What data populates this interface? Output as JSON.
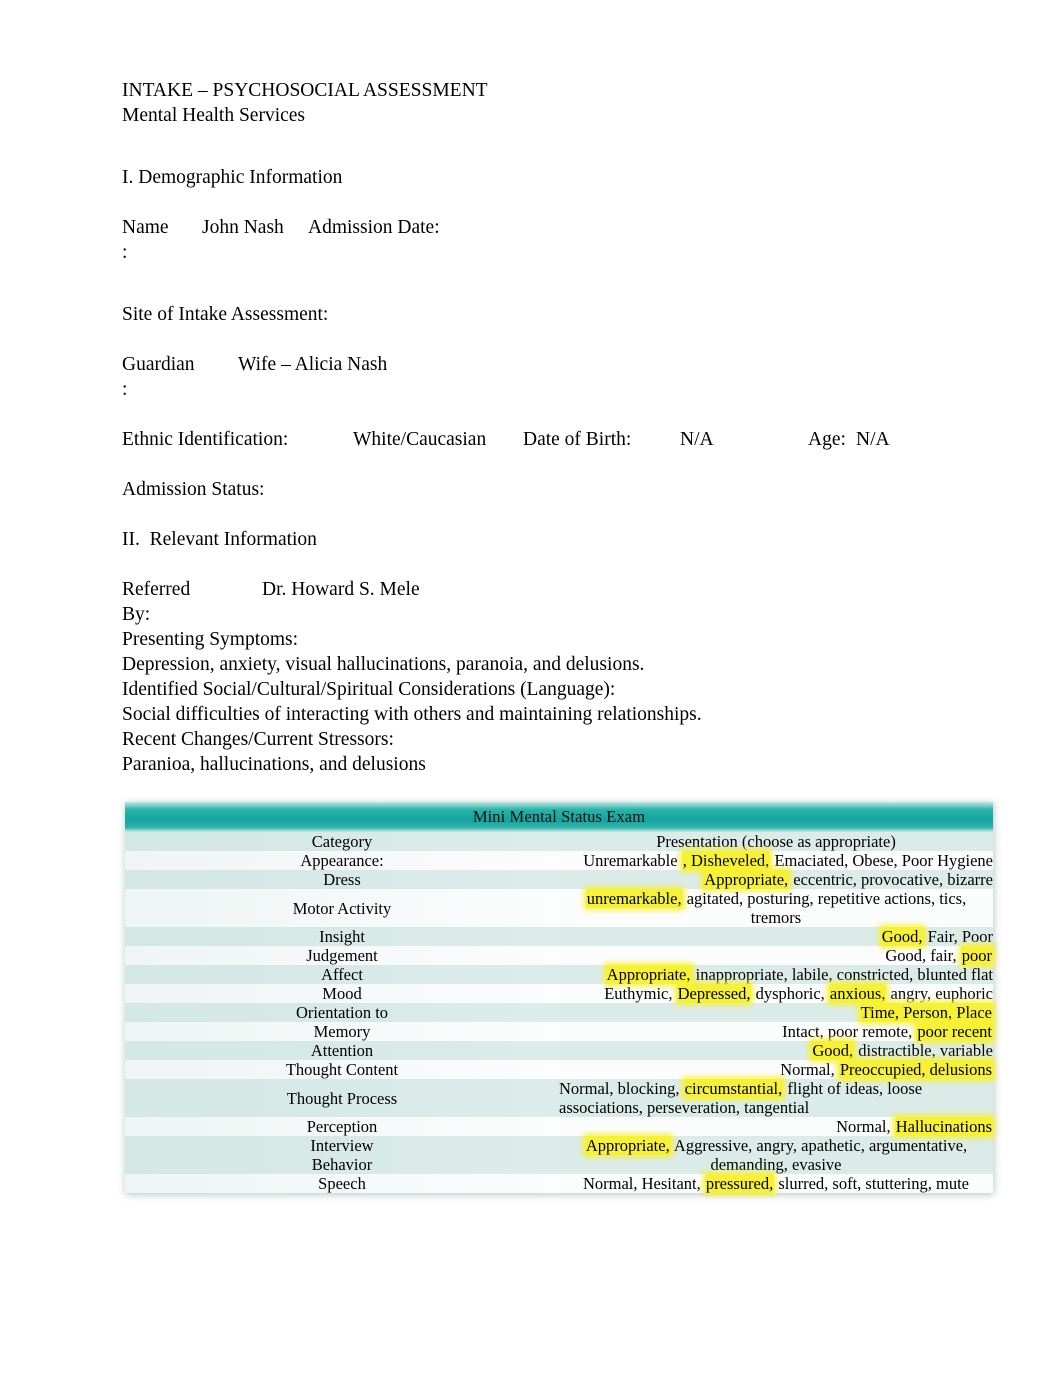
{
  "document": {
    "title_line1": "INTAKE – PSYCHOSOCIAL ASSESSMENT",
    "title_line2": "Mental Health Services",
    "section_1_heading": "I. Demographic Information",
    "section_2_heading": "II.  Relevant Information",
    "fields": {
      "name_label": "Name",
      "name_label_colon": ":",
      "name_value": "John Nash",
      "admission_date_label": "Admission Date:",
      "admission_date_value": "",
      "site_label": "Site of Intake Assessment:",
      "site_value": "",
      "guardian_label": "Guardian",
      "guardian_label_colon": ":",
      "guardian_value": "Wife – Alicia Nash",
      "ethnic_label": "Ethnic Identification:",
      "ethnic_value": "White/Caucasian",
      "dob_label": "Date of Birth:",
      "dob_value": "N/A",
      "age_label": "Age:",
      "age_value": "N/A",
      "admission_status_label": "Admission Status:",
      "admission_status_value": "",
      "referred_by_label": "Referred",
      "referred_by_label_2": "By:",
      "referred_by_value": "Dr. Howard S. Mele",
      "presenting_symptoms_label": "Presenting Symptoms:",
      "presenting_symptoms_value": "Depression, anxiety, visual hallucinations, paranoia, and delusions.",
      "considerations_label": "Identified Social/Cultural/Spiritual Considerations (Language):",
      "considerations_value": "Social difficulties of interacting with others and maintaining relationships.",
      "stressors_label": "Recent Changes/Current Stressors:",
      "stressors_value": "Paranioa, hallucinations, and delusions"
    }
  },
  "mmse_table": {
    "title": "Mini Mental Status Exam",
    "header_color": "#14a49c",
    "highlight_color": "#f7f135",
    "row_tint": "#dbebe8",
    "columns": [
      "Category",
      "Presentation (choose as appropriate)"
    ],
    "rows": [
      {
        "category": "Category",
        "align": "center",
        "segments": [
          {
            "text": "Presentation (choose as appropriate)",
            "highlight": false
          }
        ]
      },
      {
        "category": "Appearance:",
        "align": "right",
        "segments": [
          {
            "text": "Unremarkable ",
            "highlight": false
          },
          {
            "text": ", Disheveled,",
            "highlight": true
          },
          {
            "text": " Emaciated, Obese, Poor Hygiene",
            "highlight": false
          }
        ]
      },
      {
        "category": "Dress",
        "align": "right",
        "segments": [
          {
            "text": "Appropriate,",
            "highlight": true
          },
          {
            "text": " eccentric, provocative, bizarre",
            "highlight": false
          }
        ]
      },
      {
        "category": "Motor Activity",
        "align": "center",
        "segments": [
          {
            "text": "unremarkable,",
            "highlight": true
          },
          {
            "text": " agitated, posturing, repetitive actions, tics, tremors",
            "highlight": false
          }
        ]
      },
      {
        "category": "Insight",
        "align": "right",
        "segments": [
          {
            "text": "Good,",
            "highlight": true
          },
          {
            "text": " Fair, Poor",
            "highlight": false
          }
        ]
      },
      {
        "category": "Judgement",
        "align": "right",
        "segments": [
          {
            "text": "Good, fair, ",
            "highlight": false
          },
          {
            "text": " poor",
            "highlight": true
          }
        ]
      },
      {
        "category": "Affect",
        "align": "right",
        "segments": [
          {
            "text": "Appropriate,",
            "highlight": true
          },
          {
            "text": " inappropriate, labile, constricted, blunted flat",
            "highlight": false
          }
        ]
      },
      {
        "category": "Mood",
        "align": "right",
        "segments": [
          {
            "text": "Euthymic, ",
            "highlight": false
          },
          {
            "text": " Depressed,",
            "highlight": true
          },
          {
            "text": " dysphoric,    ",
            "highlight": false
          },
          {
            "text": "anxious,",
            "highlight": true
          },
          {
            "text": " angry, euphoric",
            "highlight": false
          }
        ]
      },
      {
        "category": "Orientation to",
        "align": "right",
        "segments": [
          {
            "text": "Time, Person, Place",
            "highlight": true
          }
        ]
      },
      {
        "category": "Memory",
        "align": "right",
        "segments": [
          {
            "text": "Intact, poor remote, ",
            "highlight": false
          },
          {
            "text": "  poor recent",
            "highlight": true
          }
        ]
      },
      {
        "category": "Attention",
        "align": "right",
        "segments": [
          {
            "text": "Good,",
            "highlight": true
          },
          {
            "text": " distractible, variable",
            "highlight": false
          }
        ]
      },
      {
        "category": "Thought Content",
        "align": "right",
        "segments": [
          {
            "text": "Normal, ",
            "highlight": false
          },
          {
            "text": " Preoccupied, delusions",
            "highlight": true
          }
        ]
      },
      {
        "category": "Thought Process",
        "align": "left",
        "segments": [
          {
            "text": "Normal, blocking, ",
            "highlight": false
          },
          {
            "text": " circumstantial,",
            "highlight": true
          },
          {
            "text": " flight of ideas, loose associations, perseveration, tangential",
            "highlight": false
          }
        ]
      },
      {
        "category": "Perception",
        "align": "right",
        "segments": [
          {
            "text": "Normal, ",
            "highlight": false
          },
          {
            "text": " Hallucinations",
            "highlight": true
          }
        ]
      },
      {
        "category": "Interview\nBehavior",
        "align": "center",
        "segments": [
          {
            "text": "Appropriate,",
            "highlight": true
          },
          {
            "text": " Aggressive, angry, apathetic, argumentative, demanding, evasive",
            "highlight": false
          }
        ]
      },
      {
        "category": "Speech",
        "align": "center",
        "segments": [
          {
            "text": "Normal, Hesitant, ",
            "highlight": false
          },
          {
            "text": " pressured,",
            "highlight": true
          },
          {
            "text": " slurred, soft, stuttering, mute",
            "highlight": false
          }
        ]
      }
    ]
  }
}
